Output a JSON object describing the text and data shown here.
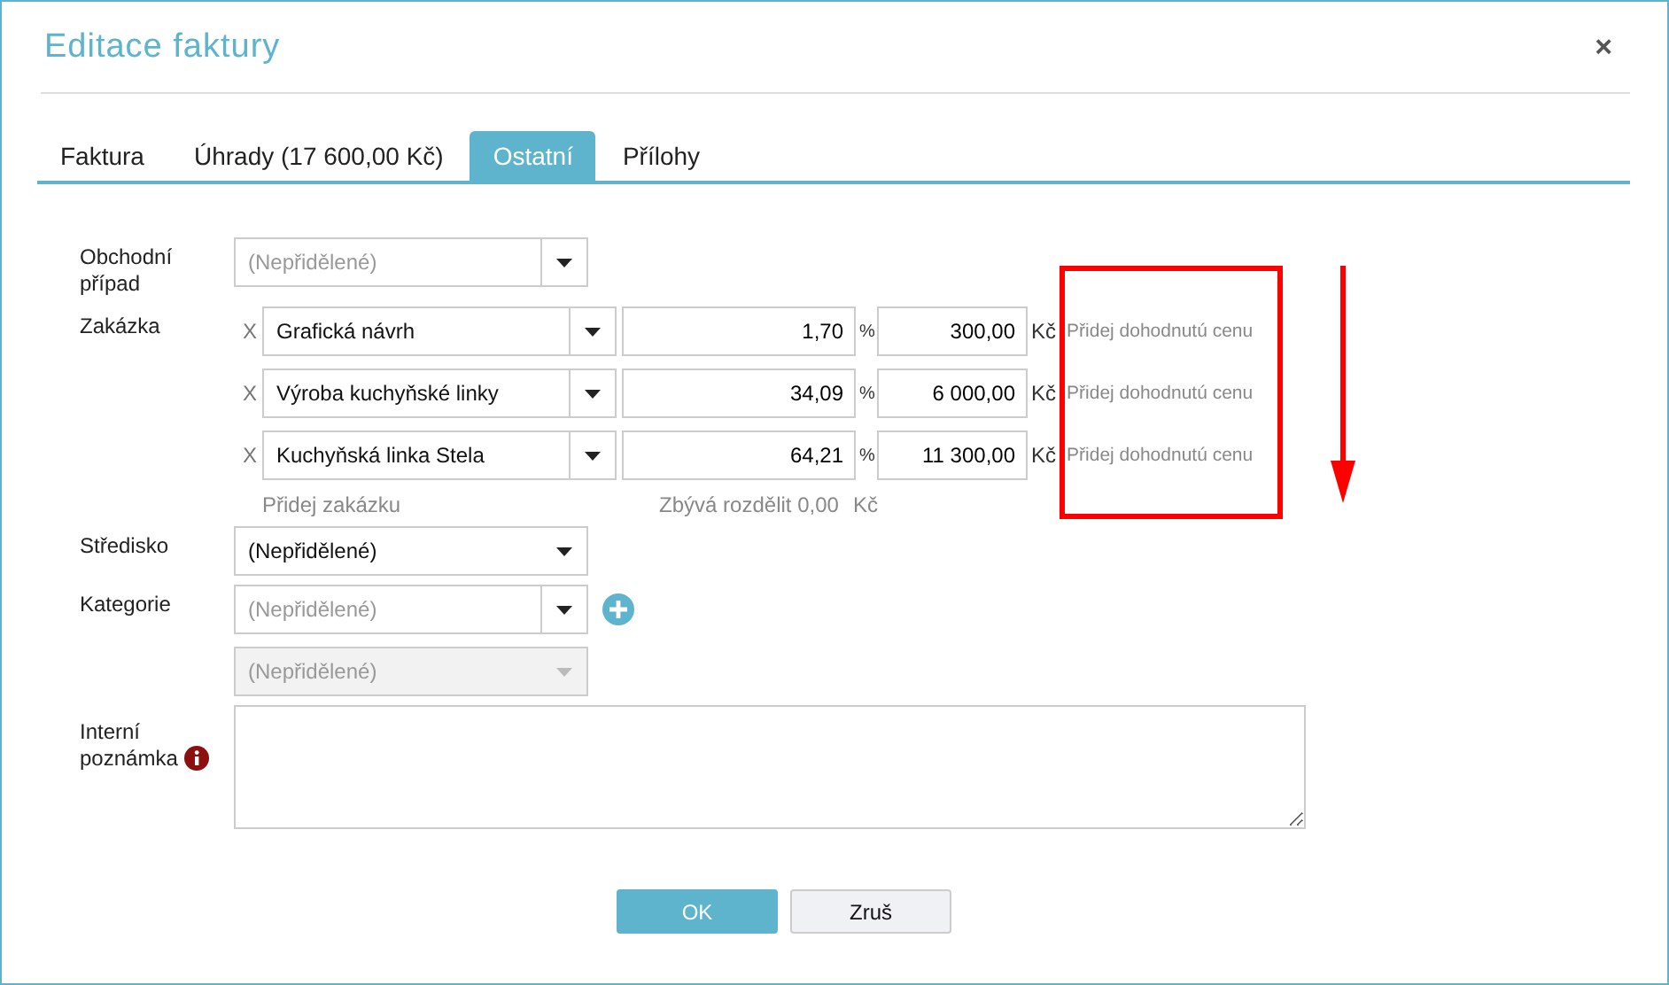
{
  "dialog": {
    "title": "Editace faktury",
    "close": "×"
  },
  "tabs": [
    {
      "label": "Faktura",
      "selected": false
    },
    {
      "label": "Úhrady (17 600,00 Kč)",
      "selected": false
    },
    {
      "label": "Ostatní",
      "selected": true
    },
    {
      "label": "Přílohy",
      "selected": false
    }
  ],
  "business_case": {
    "label": "Obchodní případ",
    "placeholder": "(Nepřidělené)"
  },
  "orders": {
    "label": "Zakázka",
    "rows": [
      {
        "remove": "X",
        "name": "Grafická návrh",
        "percent": "1,70",
        "percent_unit": "%",
        "amount": "300,00",
        "currency": "Kč",
        "link": "Přidej dohodnutú cenu"
      },
      {
        "remove": "X",
        "name": "Výroba kuchyňské linky",
        "percent": "34,09",
        "percent_unit": "%",
        "amount": "6 000,00",
        "currency": "Kč",
        "link": "Přidej dohodnutú cenu"
      },
      {
        "remove": "X",
        "name": "Kuchyňská linka Stela",
        "percent": "64,21",
        "percent_unit": "%",
        "amount": "11 300,00",
        "currency": "Kč",
        "link": "Přidej dohodnutú cenu"
      }
    ],
    "add": "Přidej zakázku",
    "remaining": "Zbývá rozdělit 0,00",
    "remaining_currency": "Kč"
  },
  "cost_center": {
    "label": "Středisko",
    "value": "(Nepřidělené)"
  },
  "category": {
    "label": "Kategorie",
    "placeholder": "(Nepřidělené)",
    "sub_placeholder": "(Nepřidělené)",
    "sub_disabled": true
  },
  "note": {
    "label": "Interní poznámka"
  },
  "buttons": [
    {
      "label": "OK",
      "kind": "primary"
    },
    {
      "label": "Zruš",
      "kind": "secondary"
    }
  ]
}
